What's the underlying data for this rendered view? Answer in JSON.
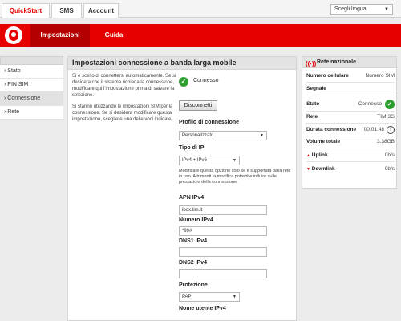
{
  "top_tabs": [
    "QuickStart",
    "SMS",
    "Account"
  ],
  "language": {
    "value": "Scegli lingua"
  },
  "nav_tabs": [
    "Impostazioni",
    "Guida"
  ],
  "sidebar": {
    "items": [
      {
        "label": "› Stato"
      },
      {
        "label": "› PIN SIM"
      },
      {
        "label": "› Connessione"
      },
      {
        "label": "› Rete"
      }
    ]
  },
  "main": {
    "title": "Impostazioni connessione a banda larga mobile",
    "para1": "Si è scelto di connettersi automaticamente. Se si desidera che il sistema richieda la connessione, modificare qui l'impostazione prima di salvare la selezione.",
    "para2": "Si stanno utilizzando le impostazioni SIM per la connessione. Se si desidera modificare questa impostazione, scegliere una delle voci indicate.",
    "status": "Connesso",
    "disconnect_label": "Disconnetti",
    "profile_label": "Profilo di connessione",
    "profile_value": "Personalizzato",
    "ip_type_label": "Tipo di IP",
    "ip_type_value": "IPv4 + IPv6",
    "ip_note": "Modificare questa opzione solo se è supportata dalla rete in uso. Altrimenti la modifica potrebbe influire sulle prestazioni della connessione.",
    "apn_label": "APN IPv4",
    "apn_value": "ibox.tim.it",
    "number_label": "Numero IPv4",
    "number_value": "*99#",
    "dns1_label": "DNS1 IPv4",
    "dns1_value": "",
    "dns2_label": "DNS2 IPv4",
    "dns2_value": "",
    "protection_label": "Protezione",
    "protection_value": "PAP",
    "username_label": "Nome utente IPv4"
  },
  "right": {
    "title": "Rete nazionale",
    "rows": {
      "phone": {
        "k": "Numero cellulare",
        "v": "Numero SIM"
      },
      "signal": {
        "k": "Segnale"
      },
      "state": {
        "k": "Stato",
        "v": "Connesso"
      },
      "network": {
        "k": "Rete",
        "v": "TIM 3G"
      },
      "duration": {
        "k": "Durata connessione",
        "v": "00:01:48"
      },
      "volume": {
        "k": "Volume totale",
        "v": "3.38GB"
      },
      "uplink": {
        "k": "Uplink",
        "v": "0b/s"
      },
      "downlink": {
        "k": "Downlink",
        "v": "0b/s"
      }
    }
  },
  "colors": {
    "brand": "#e60000",
    "ok": "#2e9e2e"
  },
  "icons": [
    "vodafone-logo-icon",
    "check-icon",
    "antenna-icon",
    "clock-icon",
    "uplink-arrow-icon",
    "downlink-arrow-icon",
    "chevron-down-icon"
  ]
}
